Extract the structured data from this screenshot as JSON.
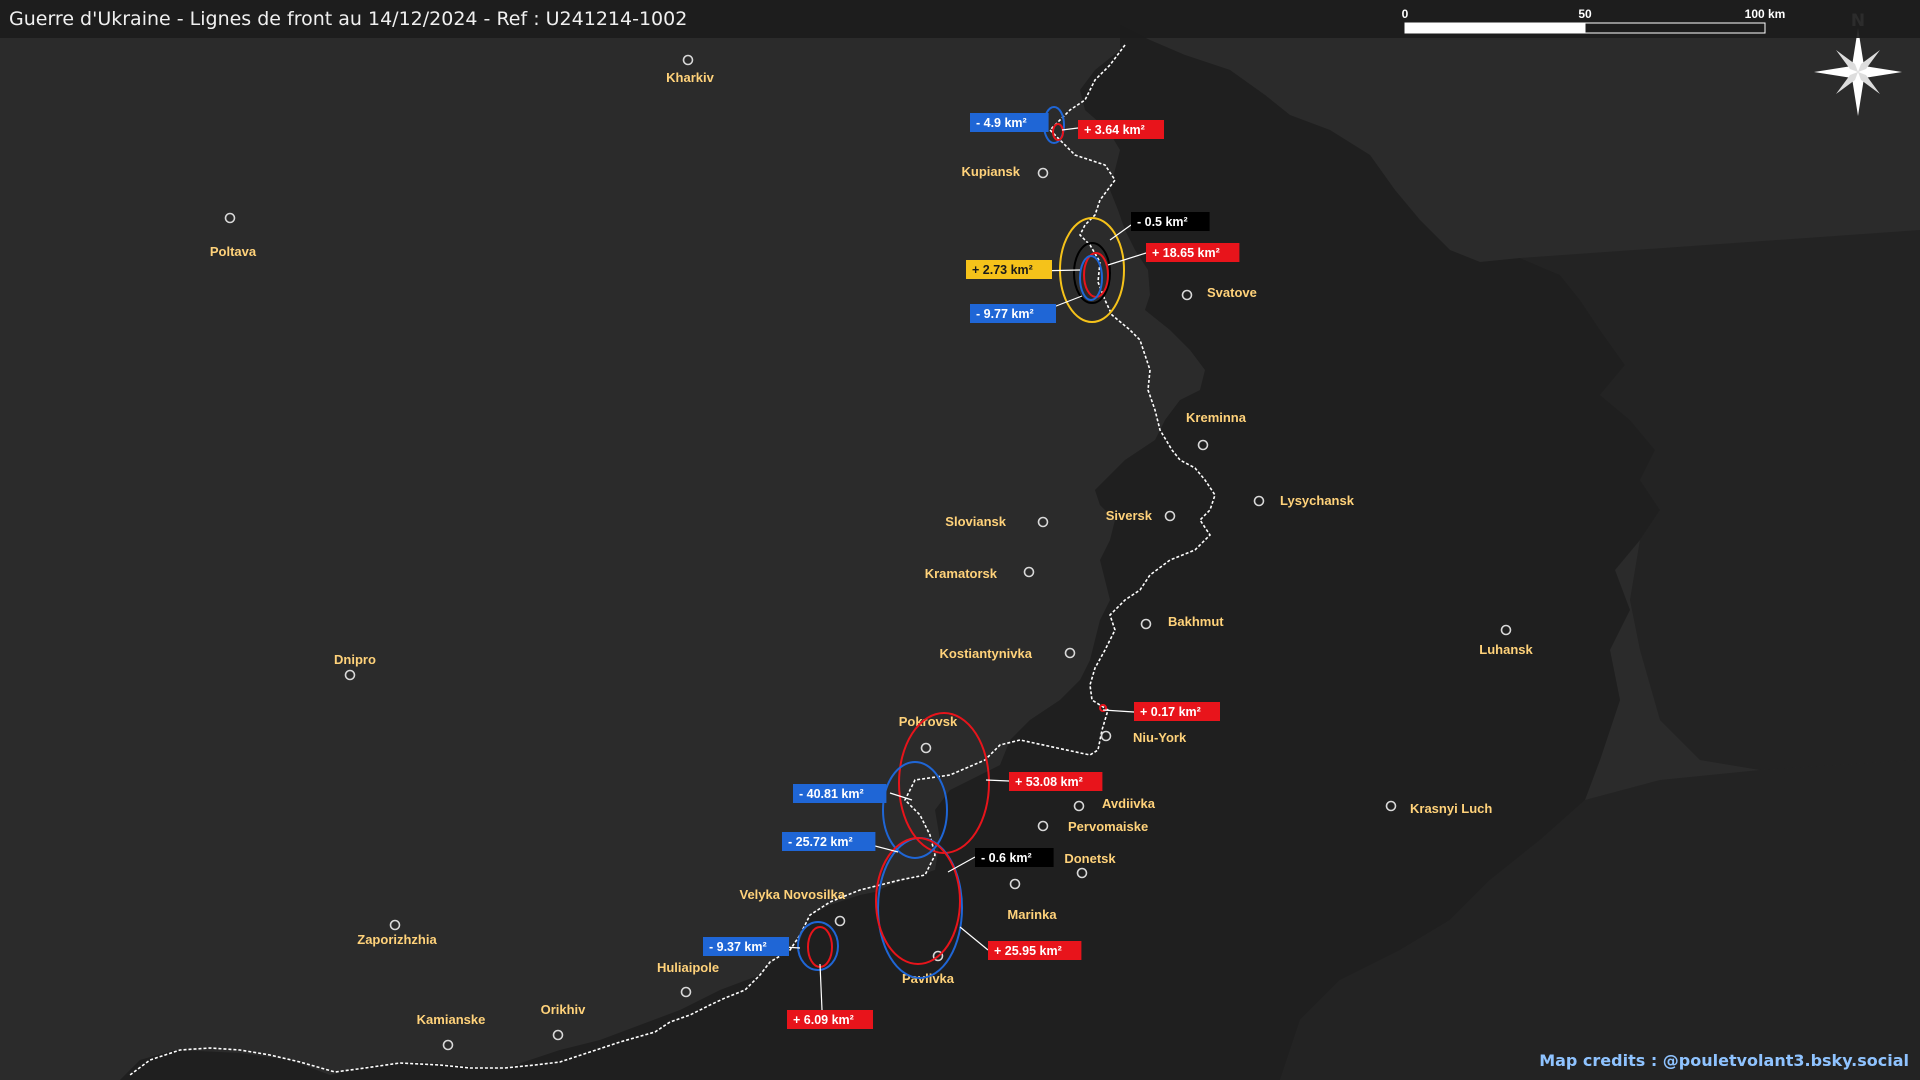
{
  "title": "Guerre d'Ukraine - Lignes de front au 14/12/2024 - Ref : U241214-1002",
  "credits": "Map credits : @pouletvolant3.bsky.social",
  "scale_bar": {
    "labels": [
      "0",
      "50",
      "100 km"
    ]
  },
  "north_label": "N",
  "colors": {
    "background": "#2b2b2b",
    "occupied": "#1f1f1f",
    "city_label": "#ffd27a",
    "front_line": "#ffffff",
    "gain_red": "#e8141b",
    "loss_blue": "#1f66d6",
    "neutral_black": "#000000",
    "yellow": "#f5c21a"
  },
  "cities": [
    {
      "name": "Kharkiv"
    },
    {
      "name": "Kupiansk"
    },
    {
      "name": "Poltava"
    },
    {
      "name": "Svatove"
    },
    {
      "name": "Kreminna"
    },
    {
      "name": "Lysychansk"
    },
    {
      "name": "Siversk"
    },
    {
      "name": "Sloviansk"
    },
    {
      "name": "Kramatorsk"
    },
    {
      "name": "Bakhmut"
    },
    {
      "name": "Luhansk"
    },
    {
      "name": "Dnipro"
    },
    {
      "name": "Kostiantynivka"
    },
    {
      "name": "Niu-York"
    },
    {
      "name": "Pokrovsk"
    },
    {
      "name": "Avdiivka"
    },
    {
      "name": "Pervomaiske"
    },
    {
      "name": "Krasnyi Luch"
    },
    {
      "name": "Donetsk"
    },
    {
      "name": "Velyka Novosilka"
    },
    {
      "name": "Marinka"
    },
    {
      "name": "Zaporizhzhia"
    },
    {
      "name": "Huliaipole"
    },
    {
      "name": "Pavlivka"
    },
    {
      "name": "Orikhiv"
    },
    {
      "name": "Kamianske"
    }
  ],
  "area_labels": [
    {
      "text": "- 4.9 km²",
      "kind": "loss"
    },
    {
      "text": "+ 3.64 km²",
      "kind": "gain"
    },
    {
      "text": "- 0.5 km²",
      "kind": "neutral"
    },
    {
      "text": "+ 18.65 km²",
      "kind": "gain"
    },
    {
      "text": "+ 2.73 km²",
      "kind": "yellow"
    },
    {
      "text": "- 9.77 km²",
      "kind": "loss"
    },
    {
      "text": "+ 0.17 km²",
      "kind": "gain"
    },
    {
      "text": "+ 53.08 km²",
      "kind": "gain"
    },
    {
      "text": "- 40.81 km²",
      "kind": "loss"
    },
    {
      "text": "- 25.72 km²",
      "kind": "loss"
    },
    {
      "text": "- 0.6 km²",
      "kind": "neutral"
    },
    {
      "text": "+ 25.95 km²",
      "kind": "gain"
    },
    {
      "text": "- 9.37 km²",
      "kind": "loss"
    },
    {
      "text": "+ 6.09 km²",
      "kind": "gain"
    }
  ]
}
